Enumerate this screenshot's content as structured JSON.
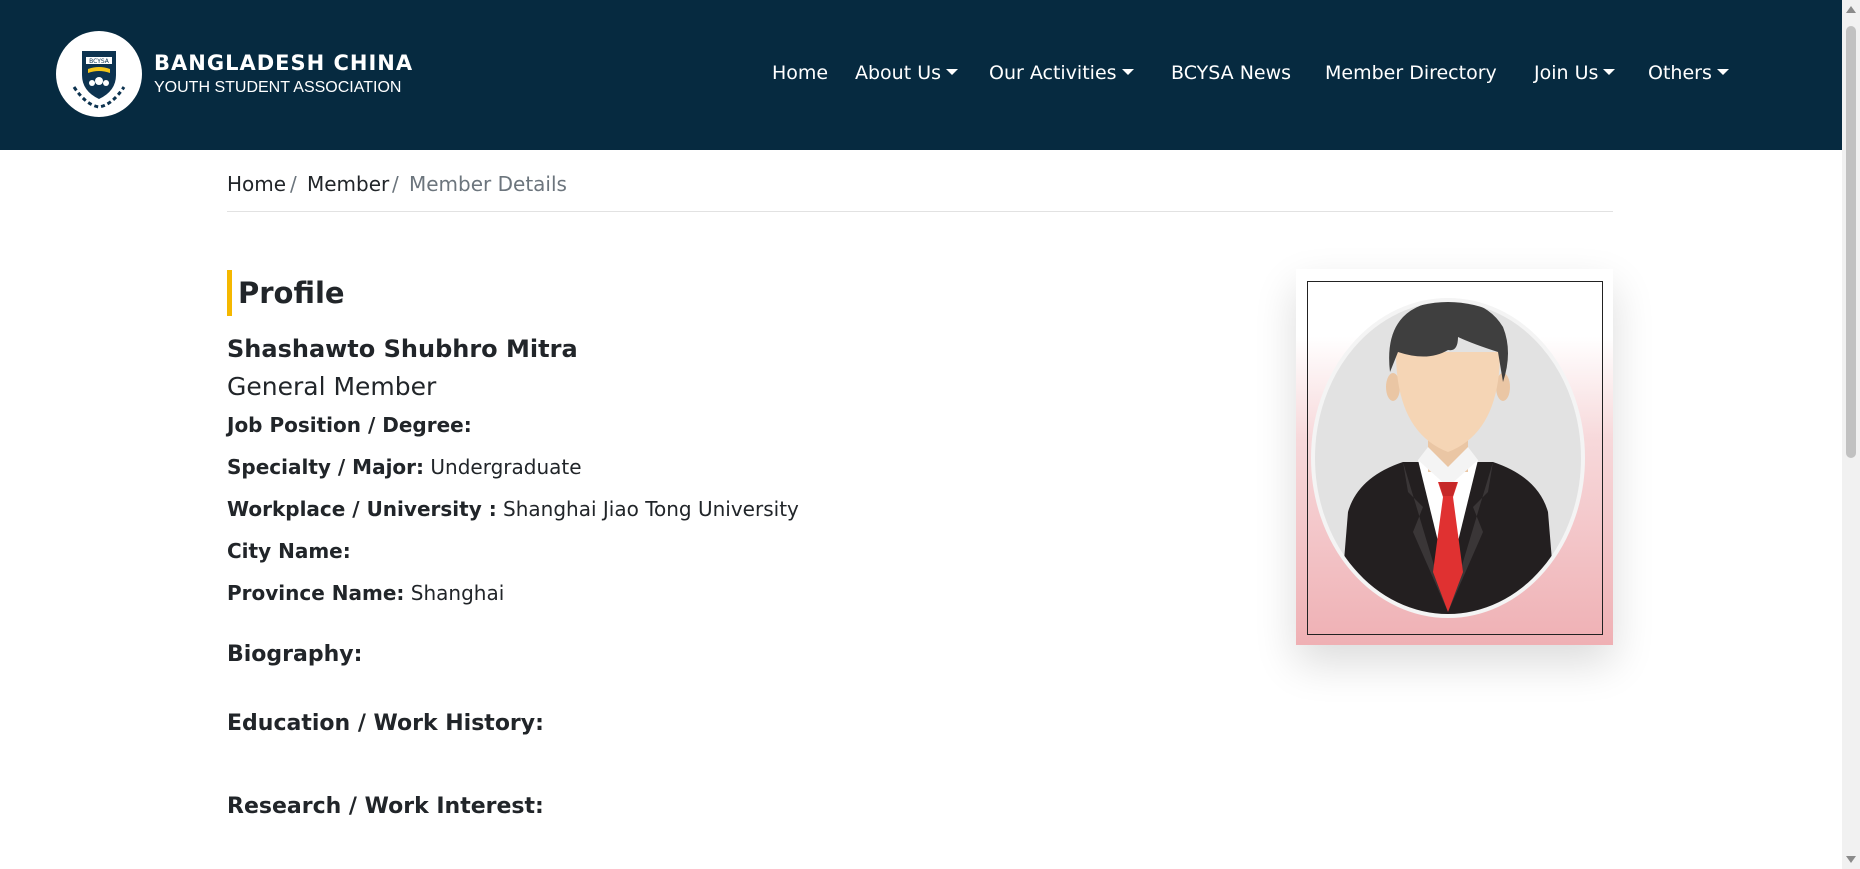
{
  "header": {
    "brand_title": "BANGLADESH CHINA",
    "brand_subtitle": "YOUTH STUDENT ASSOCIATION",
    "logo_text": "BCYSA",
    "nav": [
      {
        "label": "Home",
        "dropdown": false
      },
      {
        "label": "About Us",
        "dropdown": true
      },
      {
        "label": "Our Activities",
        "dropdown": true
      },
      {
        "label": "BCYSA News",
        "dropdown": false
      },
      {
        "label": "Member Directory",
        "dropdown": false
      },
      {
        "label": "Join Us",
        "dropdown": true
      },
      {
        "label": "Others",
        "dropdown": true
      }
    ],
    "bg_color": "#062a40"
  },
  "breadcrumb": {
    "items": [
      "Home",
      "Member",
      "Member Details"
    ],
    "separator": "/"
  },
  "profile": {
    "heading": "Profile",
    "accent_color": "#f5b800",
    "name": "Shashawto Shubhro Mitra",
    "member_type": "General Member",
    "fields": [
      {
        "label": "Job Position / Degree:",
        "value": ""
      },
      {
        "label": "Specialty / Major:",
        "value": "Undergraduate"
      },
      {
        "label": "Workplace / University :",
        "value": "Shanghai Jiao Tong University"
      },
      {
        "label": "City Name:",
        "value": ""
      },
      {
        "label": "Province Name:",
        "value": "Shanghai"
      }
    ],
    "sections": [
      {
        "label": "Biography:"
      },
      {
        "label": "Education / Work History:"
      },
      {
        "label": "Research / Work Interest:"
      }
    ],
    "photo_icon": "avatar-placeholder-icon"
  }
}
